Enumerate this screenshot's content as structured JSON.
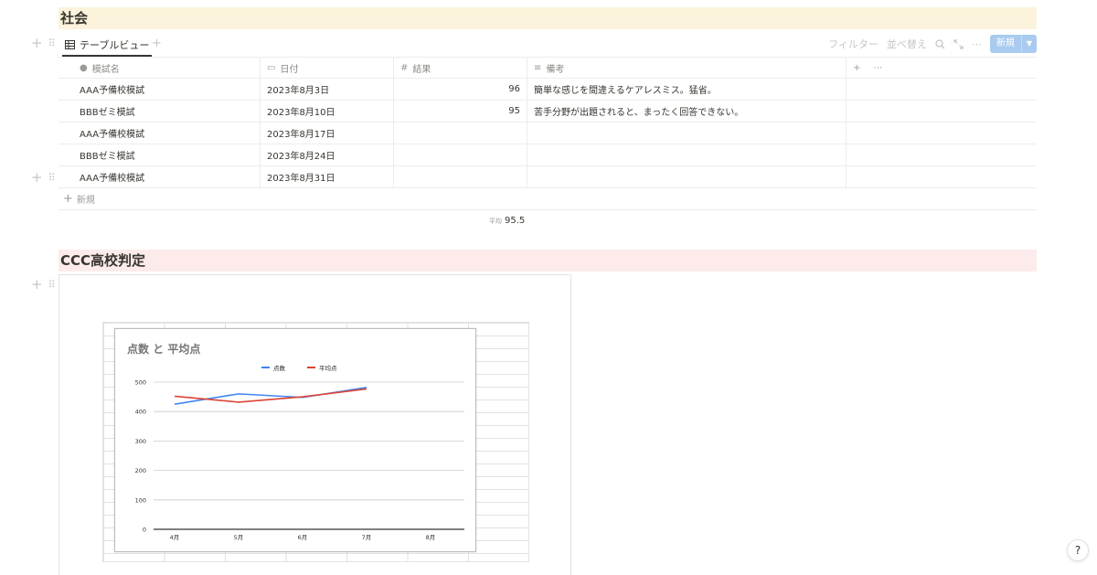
{
  "section1": {
    "title": "社会",
    "view_tab": "テーブルビュー",
    "toolbar": {
      "filter": "フィルター",
      "sort": "並べ替え",
      "new": "新規"
    },
    "columns": [
      "模試名",
      "日付",
      "結果",
      "備考"
    ],
    "rows": [
      {
        "name": "AAA予備校模試",
        "date": "2023年8月3日",
        "result": "96",
        "note": "簡単な感じを間違えるケアレスミス。猛省。"
      },
      {
        "name": "BBBゼミ模試",
        "date": "2023年8月10日",
        "result": "95",
        "note": "苦手分野が出題されると、まったく回答できない。"
      },
      {
        "name": "AAA予備校模試",
        "date": "2023年8月17日",
        "result": "",
        "note": ""
      },
      {
        "name": "BBBゼミ模試",
        "date": "2023年8月24日",
        "result": "",
        "note": ""
      },
      {
        "name": "AAA予備校模試",
        "date": "2023年8月31日",
        "result": "",
        "note": ""
      }
    ],
    "new_row": "新規",
    "average_label": "平均",
    "average_value": "95.5"
  },
  "section2": {
    "title": "CCC高校判定"
  },
  "icons": {
    "name_col": "title-icon",
    "date_col": "calendar-icon",
    "result_col": "number-icon",
    "note_col": "text-icon"
  },
  "chart_data": {
    "type": "line",
    "title": "点数 と 平均点",
    "categories": [
      "4月",
      "5月",
      "6月",
      "7月",
      "8月"
    ],
    "series": [
      {
        "name": "点数",
        "color": "#4285f4",
        "values": [
          425,
          460,
          448,
          482,
          null
        ]
      },
      {
        "name": "平均点",
        "color": "#db4437",
        "values": [
          452,
          432,
          450,
          477,
          null
        ]
      }
    ],
    "yticks": [
      "0",
      "100",
      "200",
      "300",
      "400",
      "500"
    ],
    "ylim": [
      0,
      500
    ],
    "grid": true,
    "legend": "top-center"
  },
  "help": "?"
}
